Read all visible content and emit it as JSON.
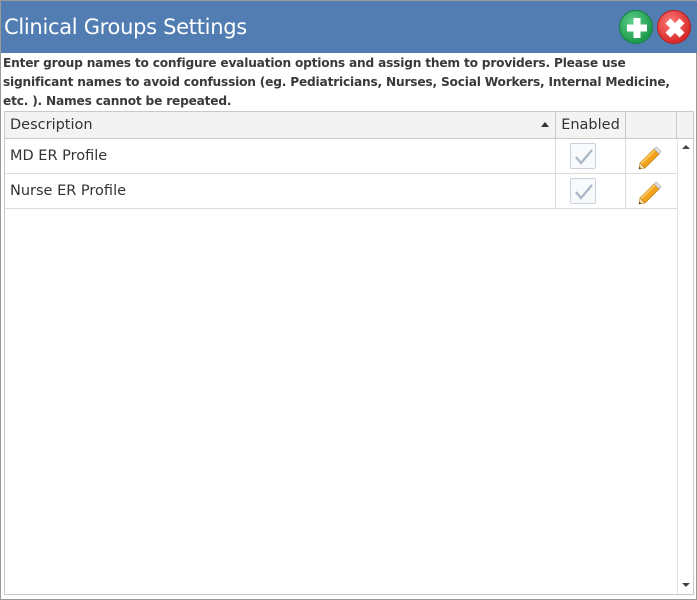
{
  "window": {
    "title": "Clinical Groups Settings"
  },
  "description": "Enter group names to configure evaluation options and assign them to providers. Please use significant names to avoid confussion (eg. Pediatricians, Nurses, Social Workers, Internal Medicine, etc. ). Names cannot be repeated.",
  "table": {
    "columns": [
      "Description",
      "Enabled",
      ""
    ],
    "sort": {
      "column": "Description",
      "direction": "ascending"
    },
    "rows": [
      {
        "description": "MD ER Profile",
        "enabled": true
      },
      {
        "description": "Nurse ER Profile",
        "enabled": true
      }
    ]
  },
  "icons": {
    "add": "plus-circle-icon",
    "close": "x-circle-icon",
    "edit": "pencil-icon",
    "check": "checkmark-icon"
  },
  "colors": {
    "titlebar": "#517db3",
    "add": "#2aa85a",
    "close": "#e03333",
    "pencil": "#f2a31b"
  }
}
